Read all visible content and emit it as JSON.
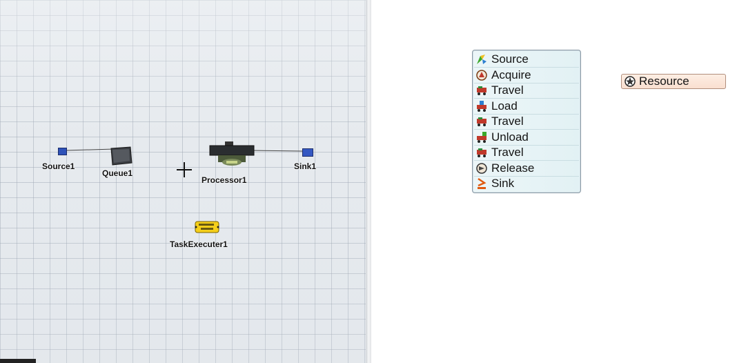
{
  "model_view": {
    "objects": {
      "source": "Source1",
      "queue": "Queue1",
      "processor": "Processor1",
      "sink": "Sink1",
      "task_executer": "TaskExecuter1"
    }
  },
  "process_flow": {
    "activities": [
      {
        "label": "Source",
        "icon": "source-icon"
      },
      {
        "label": "Acquire",
        "icon": "acquire-icon"
      },
      {
        "label": "Travel",
        "icon": "travel-icon"
      },
      {
        "label": "Load",
        "icon": "load-icon"
      },
      {
        "label": "Travel",
        "icon": "travel-icon"
      },
      {
        "label": "Unload",
        "icon": "unload-icon"
      },
      {
        "label": "Travel",
        "icon": "travel-icon"
      },
      {
        "label": "Release",
        "icon": "release-icon"
      },
      {
        "label": "Sink",
        "icon": "sink-icon"
      }
    ],
    "resource": {
      "label": "Resource",
      "icon": "resource-icon"
    }
  }
}
